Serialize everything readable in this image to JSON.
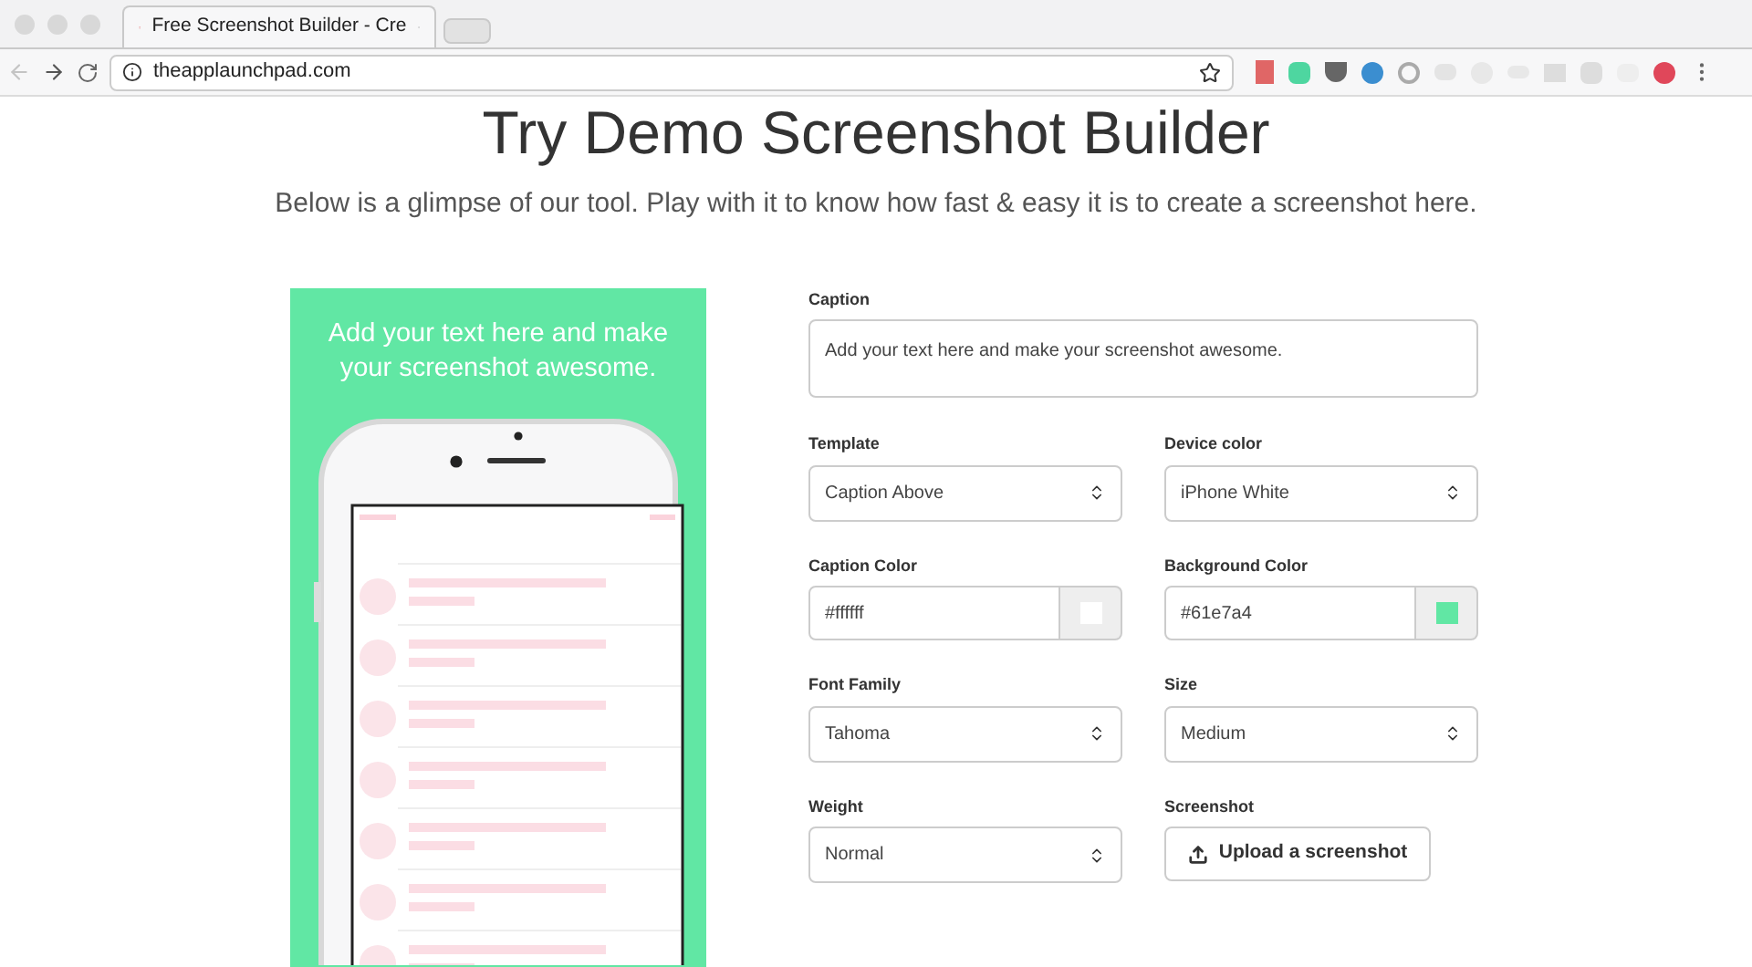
{
  "browser": {
    "tab_title": "Free Screenshot Builder - Cre",
    "url": "theapplaunchpad.com"
  },
  "page": {
    "title": "Try Demo Screenshot Builder",
    "subtitle": "Below is a glimpse of our tool. Play with it to know how fast & easy it is to create a screenshot here."
  },
  "preview": {
    "caption": "Add your text here and make your screenshot awesome."
  },
  "form": {
    "caption": {
      "label": "Caption",
      "value": "Add your text here and make your screenshot awesome."
    },
    "fields": [
      {
        "kind": "select",
        "label": "Template",
        "value": "Caption Above"
      },
      {
        "kind": "select",
        "label": "Device color",
        "value": "iPhone White"
      },
      {
        "kind": "color",
        "label": "Caption Color",
        "value": "#ffffff"
      },
      {
        "kind": "color",
        "label": "Background Color",
        "value": "#61e7a4"
      },
      {
        "kind": "select",
        "label": "Font Family",
        "value": "Tahoma"
      },
      {
        "kind": "select",
        "label": "Size",
        "value": "Medium"
      },
      {
        "kind": "select",
        "label": "Weight",
        "value": "Normal"
      },
      {
        "kind": "upload",
        "label": "Screenshot",
        "value": "Upload a screenshot"
      }
    ]
  }
}
